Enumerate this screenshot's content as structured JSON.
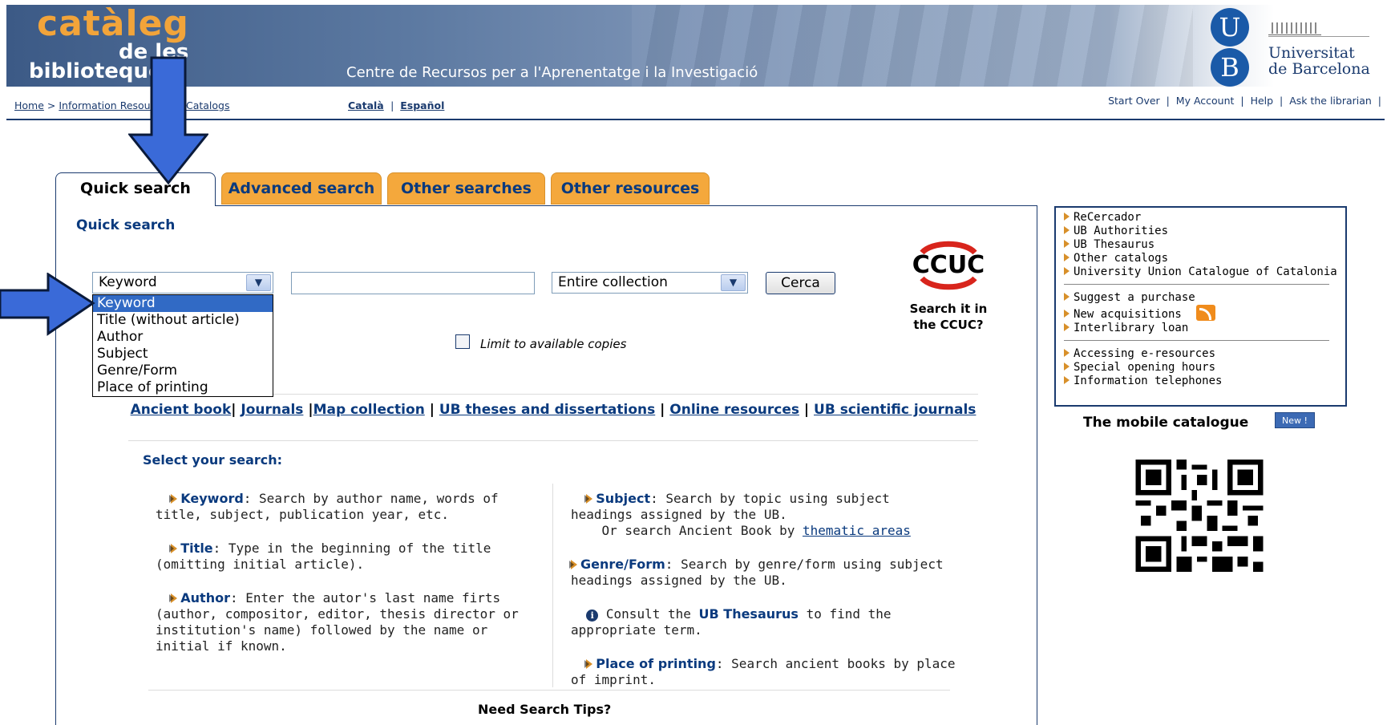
{
  "banner": {
    "logo_line1": "catàleg",
    "logo_line2": "de les",
    "logo_line3": "biblioteques",
    "subtitle": "Centre de Recursos per a l'Aprenentatge i la Investigació",
    "university_letters": [
      "U",
      "B"
    ],
    "university_name_line1": "Universitat",
    "university_name_line2": "de Barcelona"
  },
  "nav": {
    "breadcrumb": [
      "Home",
      "Information Resources",
      "Catalogs"
    ],
    "languages": [
      "Català",
      "Español"
    ],
    "top_links": [
      "Start Over",
      "My Account",
      "Help",
      "Ask the librarian"
    ]
  },
  "tabs": [
    {
      "label": "Quick search",
      "active": true
    },
    {
      "label": "Advanced search",
      "active": false
    },
    {
      "label": "Other searches",
      "active": false
    },
    {
      "label": "Other resources",
      "active": false
    }
  ],
  "main": {
    "panel_title": "Quick search",
    "search_type": {
      "selected": "Keyword",
      "options": [
        "Keyword",
        "Title (without article)",
        "Author",
        "Subject",
        "Genre/Form",
        "Place of printing"
      ]
    },
    "search_input_value": "",
    "collection": {
      "selected": "Entire collection"
    },
    "search_button": "Cerca",
    "ccuc_logo": "CCUC",
    "ccuc_text": "Search it in the CCUC?",
    "limit_label": "Limit to available copies",
    "quick_links": [
      "Ancient book",
      "Journals",
      "Map collection",
      "UB theses and dissertations",
      "Online resources",
      "UB scientific journals"
    ],
    "select_title": "Select your search:",
    "left_descriptions": [
      {
        "term": "Keyword",
        "text": ": Search by author name, words of title, subject, publication year, etc."
      },
      {
        "term": "Title",
        "text": ": Type in the beginning of the title (omitting initial article)."
      },
      {
        "term": "Author",
        "text": ": Enter the autor's last name firts (author, compositor, editor, thesis director or institution's name) followed by the name or initial if known."
      }
    ],
    "right_descriptions": {
      "subject_term": "Subject",
      "subject_text": ": Search by topic using subject headings assigned by the UB.",
      "subject_or": "Or search  Ancient Book by",
      "subject_link": "thematic areas",
      "genre_term": "Genre/Form",
      "genre_text": ": Search by genre/form using subject headings assigned by the UB.",
      "consult_prefix": "Consult the",
      "consult_link": "UB Thesaurus",
      "consult_suffix": "to find the appropriate term.",
      "place_term": "Place of printing",
      "place_text": ": Search ancient books by place of imprint."
    },
    "tips": "Need Search Tips?"
  },
  "sidebar": {
    "group1": [
      "ReCercador",
      "UB Authorities",
      "UB Thesaurus",
      "Other catalogs",
      "University Union Catalogue of Catalonia"
    ],
    "group2": [
      "Suggest a purchase",
      "New acquisitions",
      "Interlibrary loan"
    ],
    "group3": [
      "Accessing e-resources",
      "Special opening hours",
      "Information telephones"
    ],
    "mobile_title": "The mobile catalogue",
    "new_badge": "New !"
  },
  "colors": {
    "brand_blue": "#1a3a6e",
    "tab_orange": "#f4a83c",
    "link_blue": "#0a3a7e",
    "annotation_arrow": "#3a6ad8"
  }
}
